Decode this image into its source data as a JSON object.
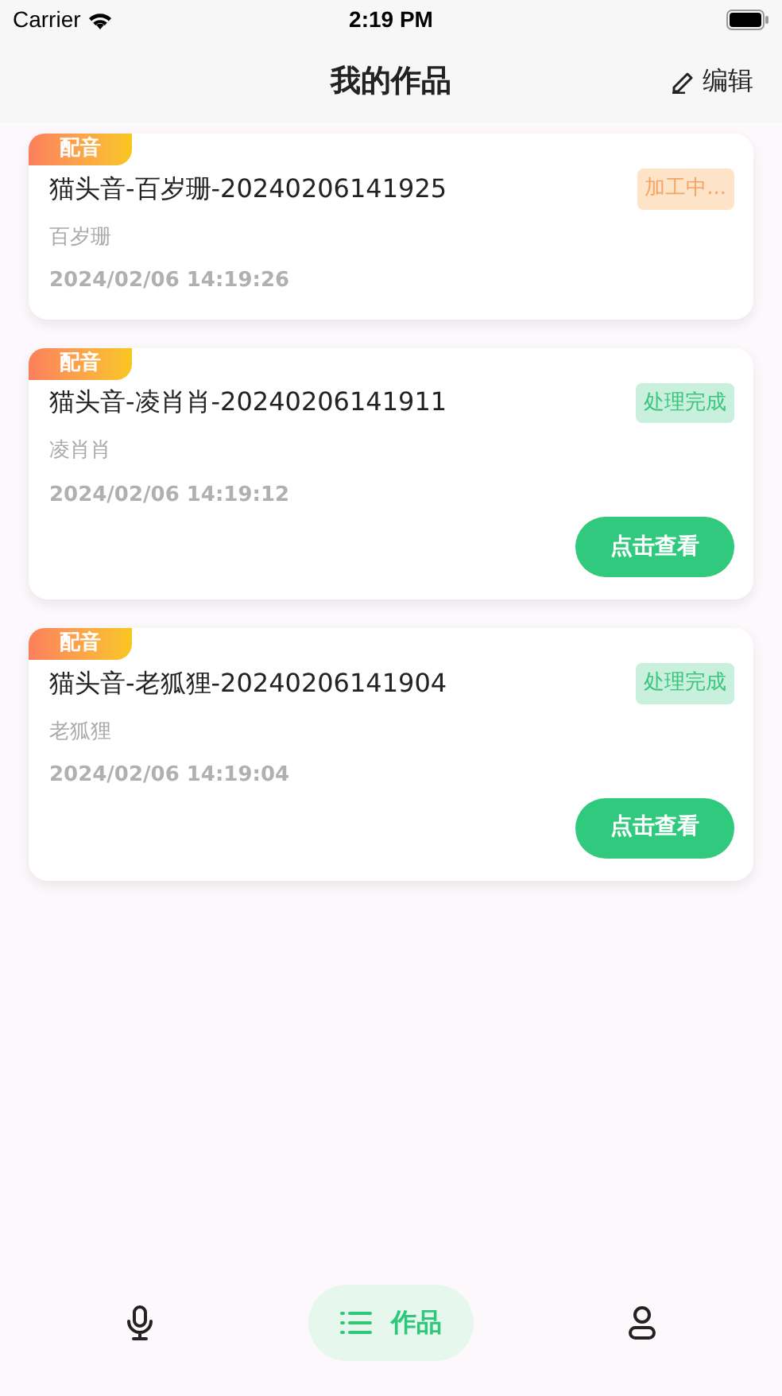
{
  "status_bar": {
    "carrier": "Carrier",
    "time": "2:19 PM"
  },
  "header": {
    "title": "我的作品",
    "action": "编辑"
  },
  "works": [
    {
      "tag": "配音",
      "title": "猫头音-百岁珊-20240206141925",
      "status": {
        "kind": "processing",
        "label": "加工中..."
      },
      "voice": "百岁珊",
      "time": "2024/02/06 14:19:26"
    },
    {
      "tag": "配音",
      "title": "猫头音-凌肖肖-20240206141911",
      "status": {
        "kind": "done",
        "label": "处理完成"
      },
      "voice": "凌肖肖",
      "time": "2024/02/06 14:19:12",
      "button": "点击查看"
    },
    {
      "tag": "配音",
      "title": "猫头音-老狐狸-20240206141904",
      "status": {
        "kind": "done",
        "label": "处理完成"
      },
      "voice": "老狐狸",
      "time": "2024/02/06 14:19:04",
      "button": "点击查看"
    }
  ],
  "tab_bar": [
    {
      "kind": "mic",
      "selected": false
    },
    {
      "kind": "list",
      "label": "作品",
      "selected": true
    },
    {
      "kind": "user",
      "selected": false
    }
  ]
}
